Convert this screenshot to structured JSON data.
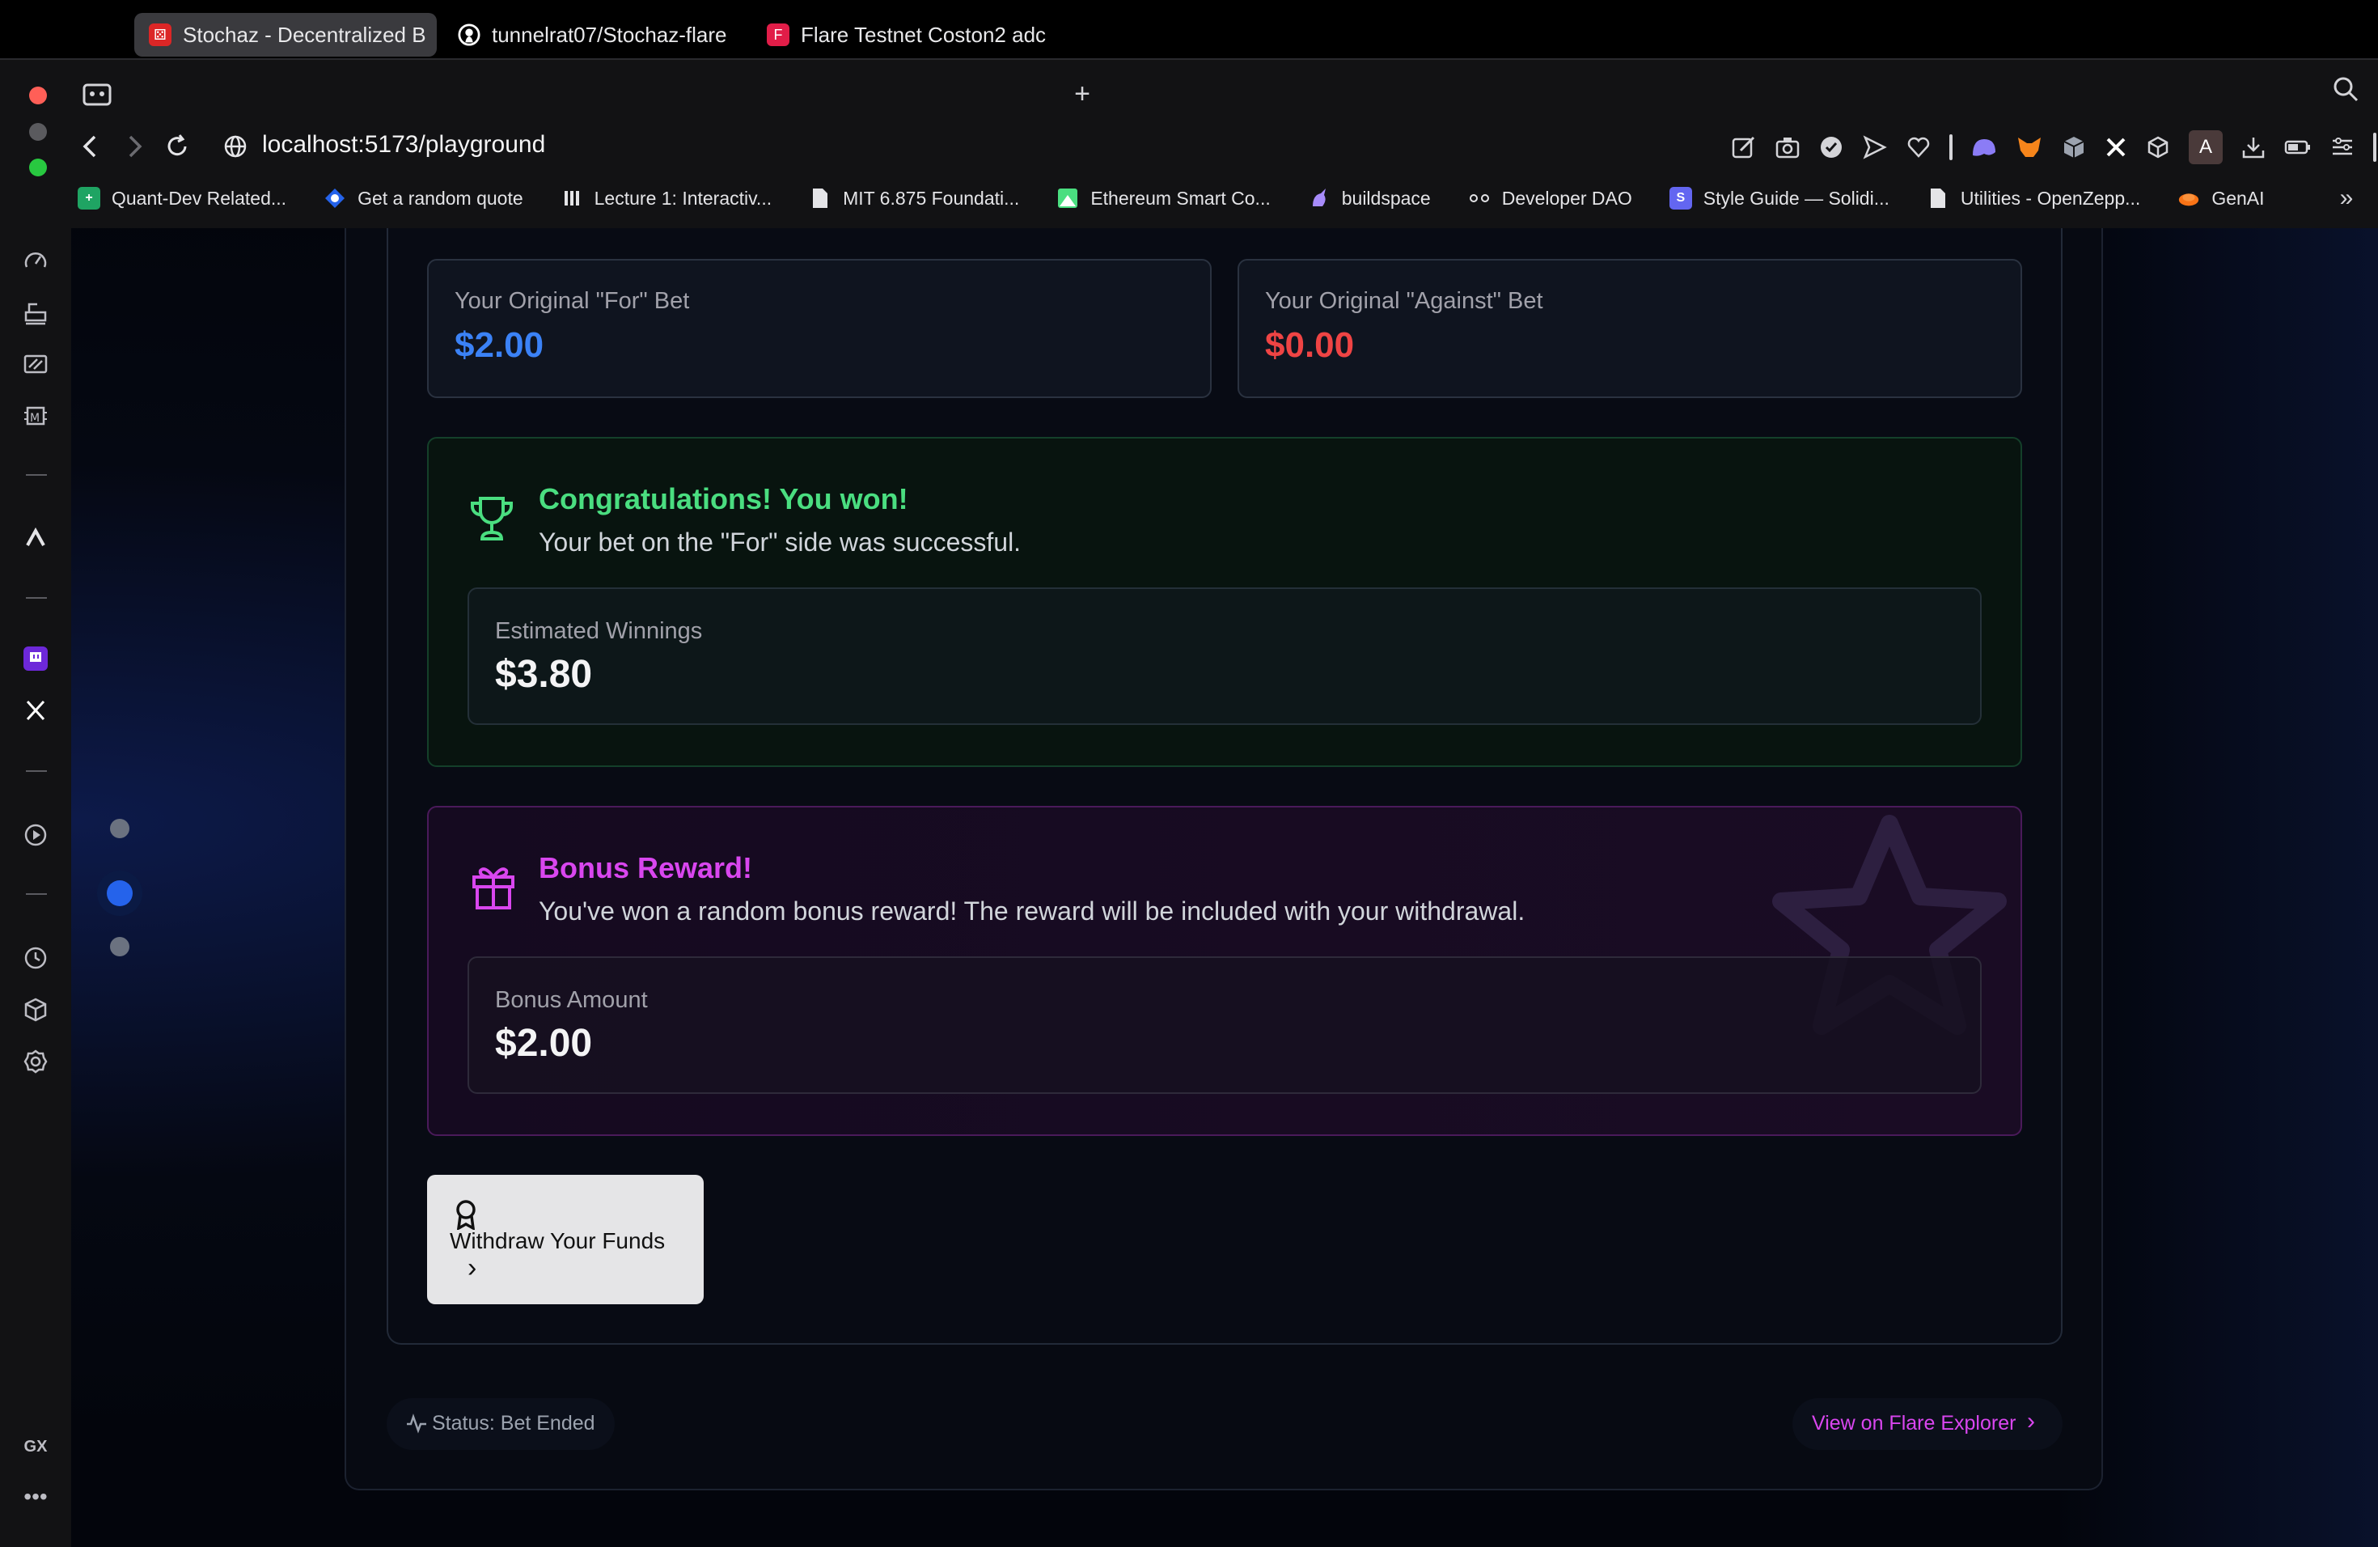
{
  "browser": {
    "tabs": [
      {
        "title": "Stochaz - Decentralized B",
        "active": true
      },
      {
        "title": "tunnelrat07/Stochaz-flare",
        "active": false
      },
      {
        "title": "Flare Testnet Coston2 adc",
        "active": false
      }
    ],
    "new_tab_label": "+",
    "url": "localhost:5173/playground",
    "bookmarks": [
      {
        "label": "Quant-Dev Related...",
        "icon": "sheet-icon",
        "color": "#1fa463"
      },
      {
        "label": "Get a random quote",
        "icon": "diamond-icon",
        "color": "#2563eb"
      },
      {
        "label": "Lecture 1: Interactiv...",
        "icon": "bars-icon",
        "color": "#e4e4e7"
      },
      {
        "label": "MIT 6.875 Foundati...",
        "icon": "doc-icon",
        "color": "#e4e4e7"
      },
      {
        "label": "Ethereum Smart Co...",
        "icon": "image-icon",
        "color": "#4ade80"
      },
      {
        "label": "buildspace",
        "icon": "unicorn-icon",
        "color": "#a78bfa"
      },
      {
        "label": "Developer DAO",
        "icon": "dao-icon",
        "color": "#e4e4e7"
      },
      {
        "label": "Style Guide — Solidi...",
        "icon": "solidity-icon",
        "color": "#6366f1"
      },
      {
        "label": "Utilities - OpenZepp...",
        "icon": "doc-icon",
        "color": "#e4e4e7"
      },
      {
        "label": "GenAI",
        "icon": "genai-icon",
        "color": "#f97316"
      }
    ],
    "profile_initial": "A",
    "sidebar_bottom_label": "GX"
  },
  "bets": {
    "for_label": "Your Original \"For\" Bet",
    "for_value": "$2.00",
    "against_label": "Your Original \"Against\" Bet",
    "against_value": "$0.00"
  },
  "win": {
    "title": "Congratulations! You won!",
    "subtitle": "Your bet on the \"For\" side was successful.",
    "winnings_label": "Estimated Winnings",
    "winnings_value": "$3.80"
  },
  "bonus": {
    "title": "Bonus Reward!",
    "subtitle": "You've won a random bonus reward! The reward will be included with your withdrawal.",
    "amount_label": "Bonus Amount",
    "amount_value": "$2.00"
  },
  "withdraw": {
    "label": "Withdraw Your Funds",
    "chevron": "›"
  },
  "footer": {
    "status": "Status: Bet Ended",
    "explorer_link": "View on Flare Explorer",
    "explorer_chevron": "›"
  },
  "colors": {
    "for_blue": "#3b82f6",
    "against_red": "#ef4444",
    "win_green": "#4ade80",
    "bonus_pink": "#d946ef",
    "link_pink": "#d946ef"
  }
}
